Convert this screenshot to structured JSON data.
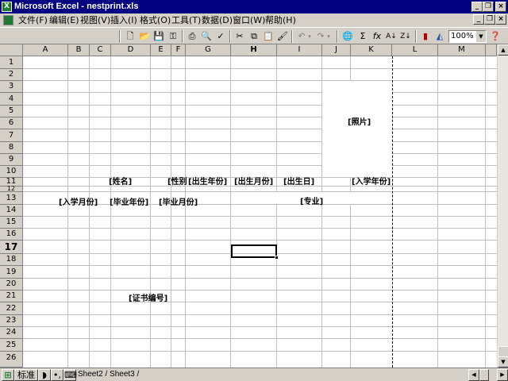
{
  "window": {
    "title": "Microsoft Excel - nestprint.xls",
    "controls": [
      "minimize",
      "restore",
      "close"
    ]
  },
  "menu": {
    "items": [
      "文件(F)",
      "编辑(E)",
      "视图(V)",
      "插入(I)",
      "格式(O)",
      "工具(T)",
      "数据(D)",
      "窗口(W)",
      "帮助(H)"
    ]
  },
  "toolbar": {
    "zoom": "100%",
    "icons": [
      "new-icon",
      "open-icon",
      "save-icon",
      "permission-icon",
      "print-icon",
      "print-preview-icon",
      "spelling-icon",
      "cut-icon",
      "copy-icon",
      "paste-icon",
      "format-painter-icon",
      "undo-icon",
      "redo-icon",
      "hyperlink-icon",
      "autosum-icon",
      "function-icon",
      "sort-ascending-icon",
      "sort-descending-icon",
      "chart-wizard-icon",
      "drawing-icon",
      "help-icon"
    ]
  },
  "sheet": {
    "columns": [
      "A",
      "B",
      "C",
      "D",
      "E",
      "F",
      "G",
      "H",
      "I",
      "J",
      "K",
      "L",
      "M"
    ],
    "rows": [
      "1",
      "2",
      "3",
      "4",
      "5",
      "6",
      "7",
      "8",
      "9",
      "10",
      "11",
      "12",
      "13",
      "14",
      "15",
      "16",
      "17",
      "18",
      "19",
      "20",
      "21",
      "22",
      "23",
      "24",
      "25",
      "26"
    ],
    "active_column": "H",
    "active_row": "17",
    "cells": {
      "photo": "[照片]",
      "name": "[姓名]",
      "gender": "[性别",
      "birth_year": "[出生年份]",
      "birth_month": "[出生月份]",
      "birth_day": "[出生日]",
      "enroll_year": "[入学年份]",
      "enroll_month": "[入学月份]",
      "grad_year": "[毕业年份]",
      "grad_month": "[毕业月份]",
      "major": "[专业]",
      "cert_no": "[证书编号]"
    }
  },
  "bottom": {
    "ime_mode": "标准",
    "sheet_tabs": "Sheet2 / Sheet3 /"
  }
}
